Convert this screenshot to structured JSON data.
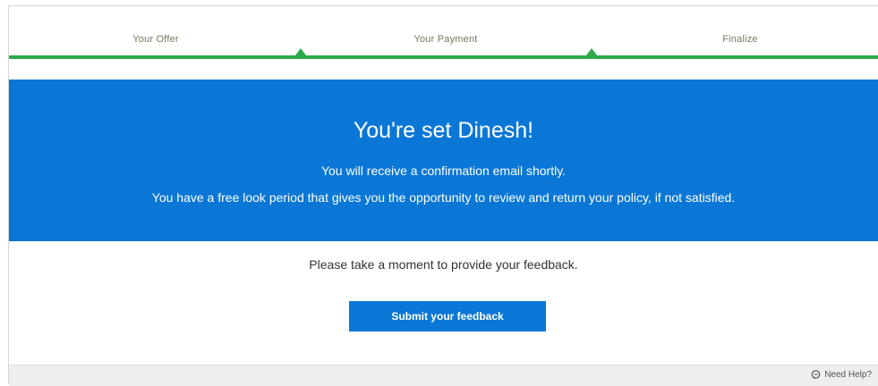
{
  "stepper": {
    "steps": [
      {
        "label": "Your Offer"
      },
      {
        "label": "Your Payment"
      },
      {
        "label": "Finalize"
      }
    ],
    "color": "#2da84b"
  },
  "banner": {
    "title": "You're set Dinesh!",
    "line1": "You will receive a confirmation email shortly.",
    "line2": "You have a free look period that gives you the opportunity to review and return your policy, if not satisfied.",
    "background": "#0a77d6"
  },
  "feedback": {
    "prompt": "Please take a moment to provide your feedback.",
    "button_label": "Submit your feedback"
  },
  "footer": {
    "help_label": "Need Help?",
    "help_icon": "chat-bubble-icon"
  }
}
